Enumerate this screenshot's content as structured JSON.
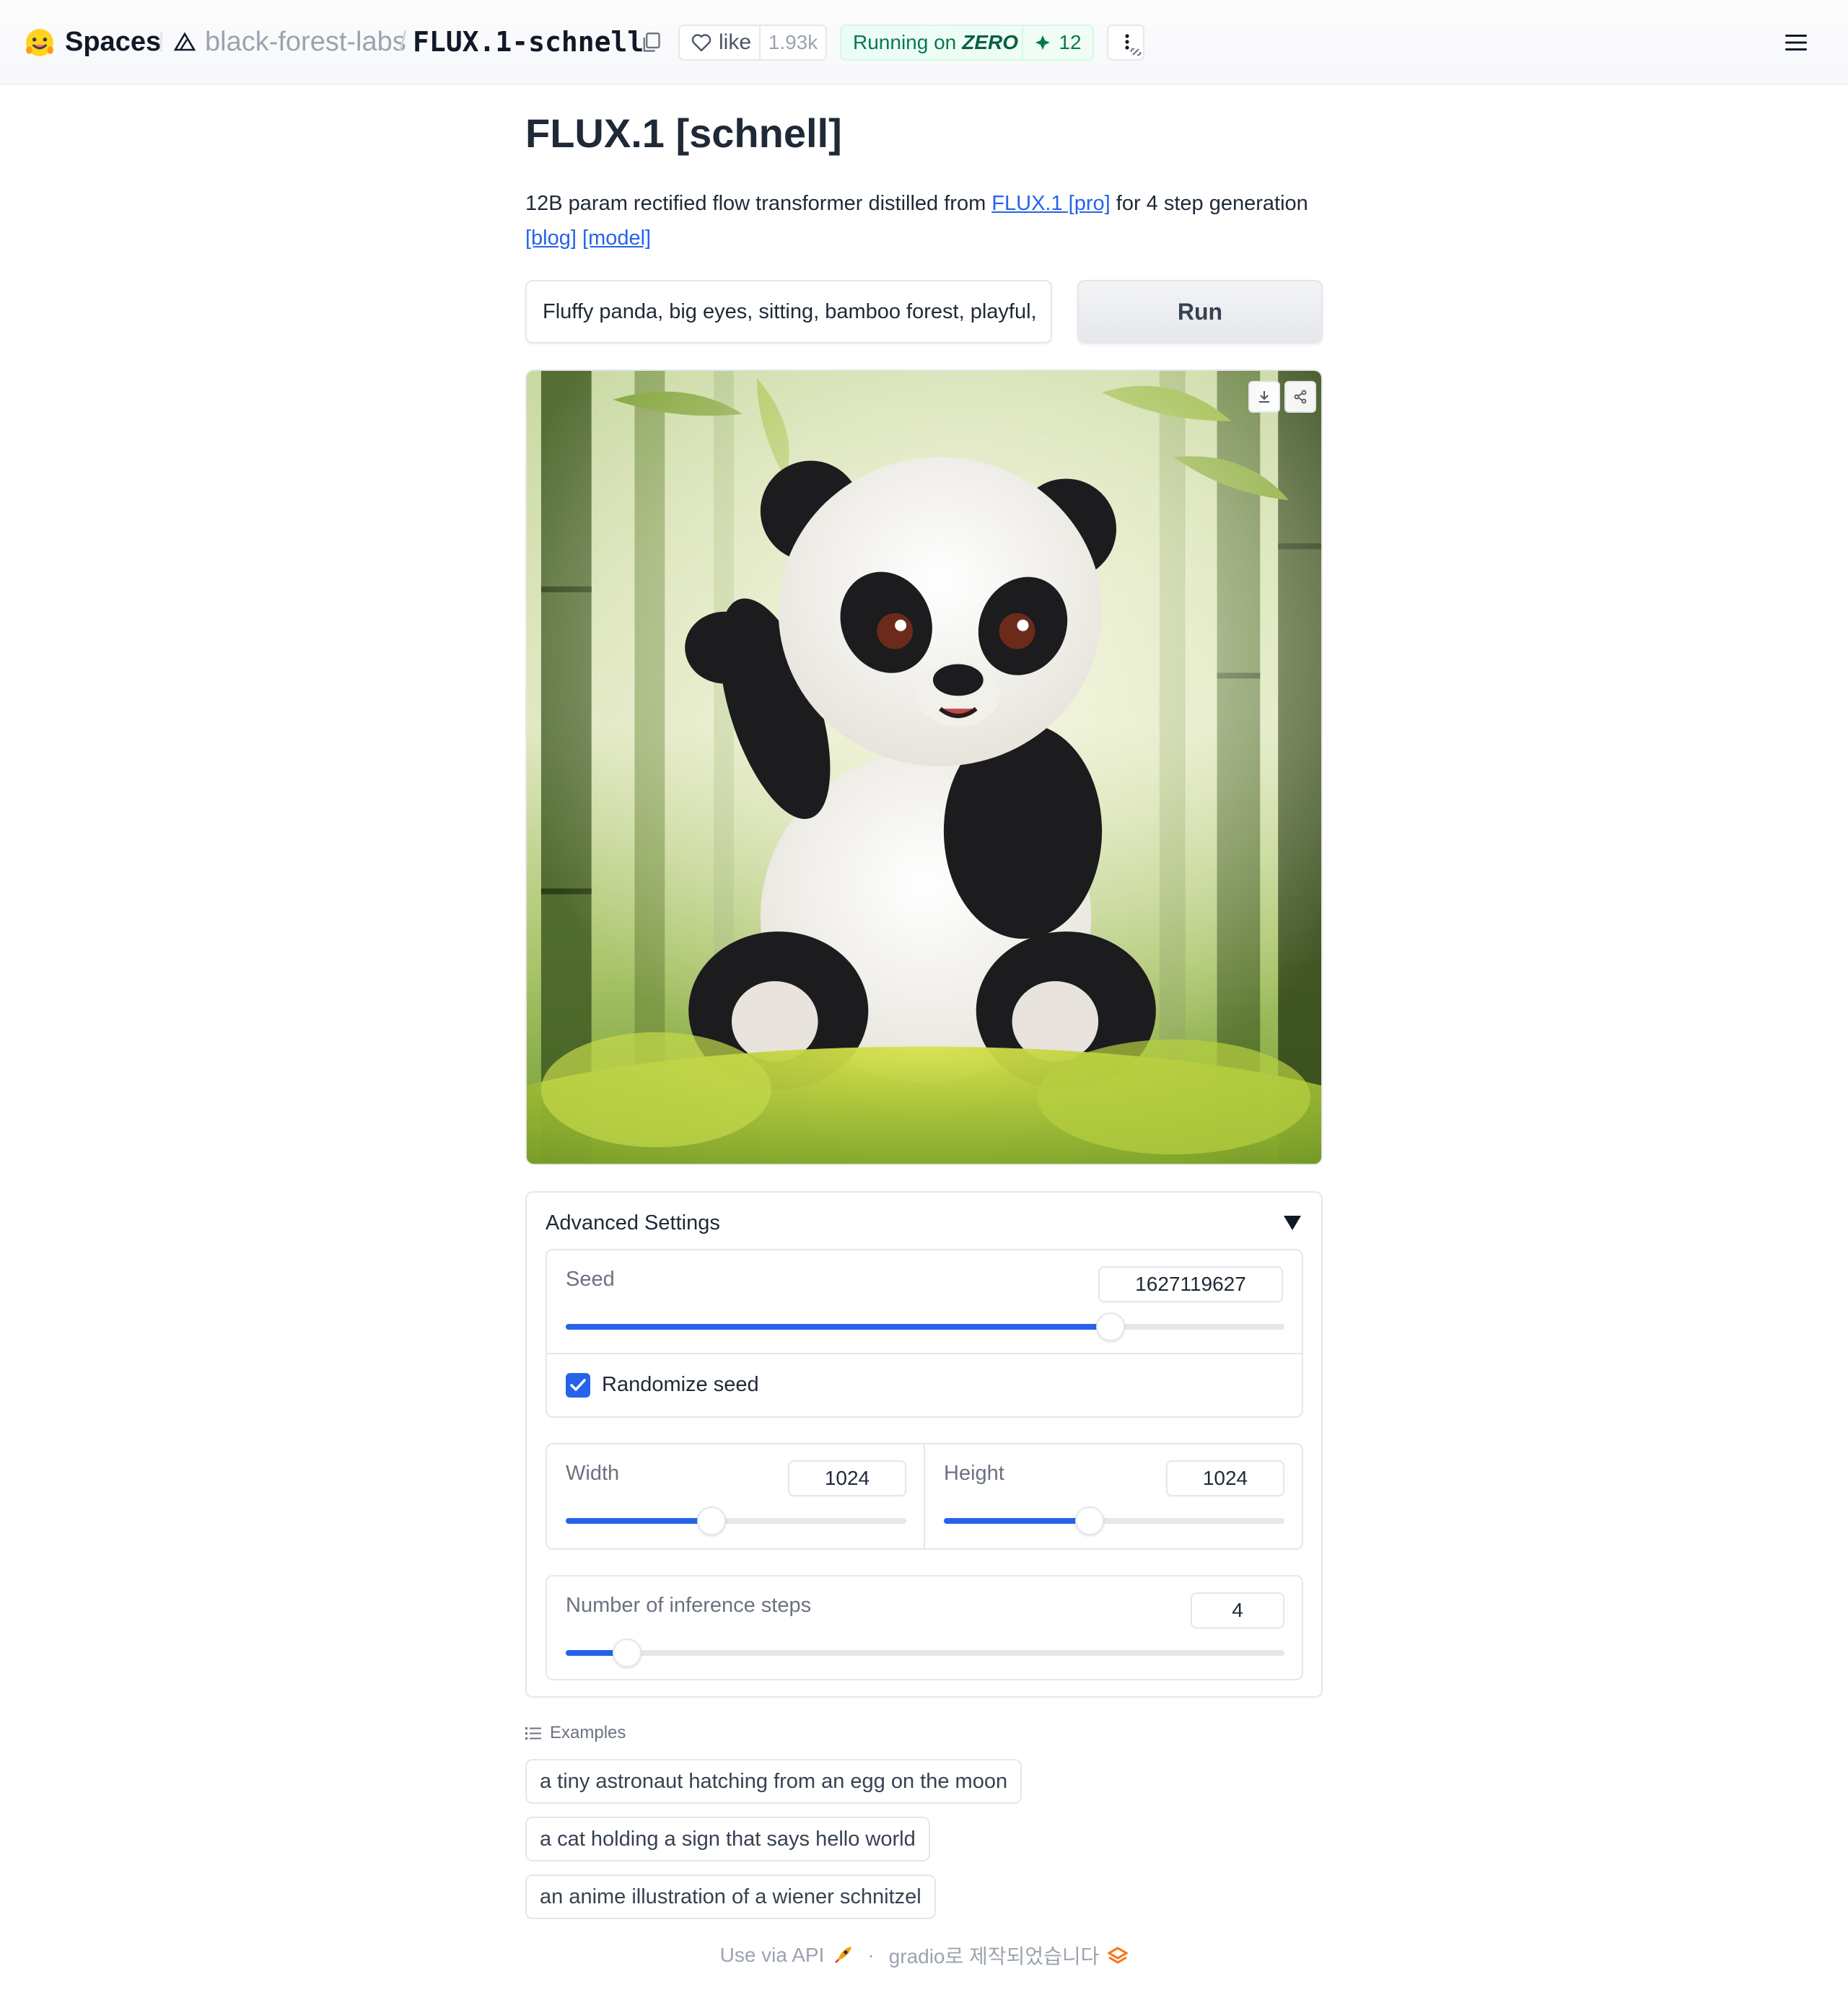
{
  "topbar": {
    "spaces_label": "Spaces",
    "org": "black-forest-labs",
    "separator": "/",
    "repo": "FLUX.1-schnell",
    "like_label": "like",
    "like_count": "1.93k",
    "running_label": "Running on",
    "running_hw": "ZERO",
    "zero_count": "12"
  },
  "page": {
    "title": "FLUX.1 [schnell]",
    "desc_prefix": "12B param rectified flow transformer distilled from ",
    "desc_link1": "FLUX.1 [pro]",
    "desc_suffix": " for 4 step generation",
    "link_blog": "[blog]",
    "link_model": "[model]"
  },
  "prompt": {
    "value": "Fluffy panda, big eyes, sitting, bamboo forest, playful, soft lighting"
  },
  "run_label": "Run",
  "settings": {
    "title": "Advanced Settings",
    "seed_label": "Seed",
    "seed_value": "1627119627",
    "seed_fraction": 0.7577,
    "randomize_label": "Randomize seed",
    "randomize_checked": true,
    "width_label": "Width",
    "width_value": "1024",
    "width_fraction": 0.4286,
    "height_label": "Height",
    "height_value": "1024",
    "height_fraction": 0.4286,
    "steps_label": "Number of inference steps",
    "steps_value": "4",
    "steps_fraction": 0.0857
  },
  "examples": {
    "header": "Examples",
    "items": [
      "a tiny astronaut hatching from an egg on the moon",
      "a cat holding a sign that says hello world",
      "an anime illustration of a wiener schnitzel"
    ]
  },
  "footer": {
    "api_label": "Use via API",
    "separator": "·",
    "built_with": "gradio로 제작되었습니다"
  },
  "colors": {
    "accent": "#2563eb",
    "running_green": "#047857"
  }
}
